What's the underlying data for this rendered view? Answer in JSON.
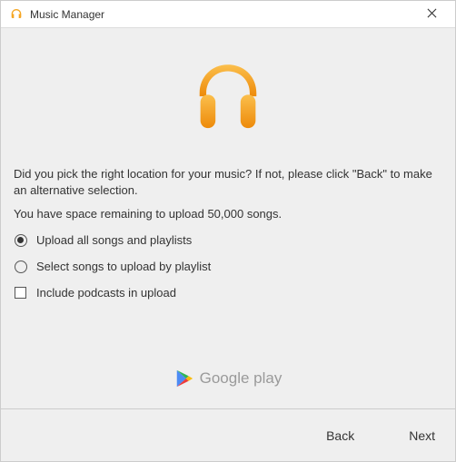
{
  "window": {
    "title": "Music Manager"
  },
  "main": {
    "message_primary": "Did you pick the right location for your music? If not, please click \"Back\" to make an alternative selection.",
    "message_secondary": "You have space remaining to upload 50,000 songs.",
    "options": {
      "radio1": "Upload all songs and playlists",
      "radio2": "Select songs to upload by playlist",
      "checkbox1": "Include podcasts in upload",
      "selected_radio": 1,
      "checkbox_checked": false
    },
    "brand": "Google play"
  },
  "footer": {
    "back_label": "Back",
    "next_label": "Next"
  },
  "icons": {
    "app": "headphones-icon",
    "close": "close-icon",
    "brand": "google-play-logo"
  },
  "colors": {
    "accent_orange": "#f5a623",
    "accent_orange_dark": "#e98a0c",
    "play_green": "#2fb457",
    "play_red": "#ed3b3b",
    "play_yellow": "#f9bd0e",
    "play_blue": "#4c8bf5"
  }
}
